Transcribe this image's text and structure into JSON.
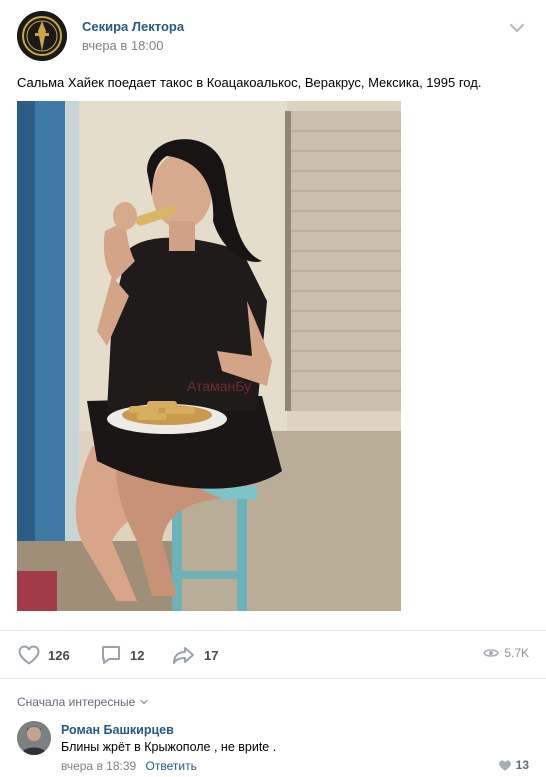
{
  "post": {
    "author": "Секира Лектора",
    "time": "вчера в 18:00",
    "text": "Сальма Хайек поедает такос в Коацакоалькос, Веракрус, Мексика, 1995 год.",
    "photo_watermark": "АтаманБу..."
  },
  "actions": {
    "likes": "126",
    "comments": "12",
    "shares": "17",
    "views": "5.7K"
  },
  "comments_section": {
    "sort_label": "Сначала интересные"
  },
  "comment": {
    "author": "Роман Башкирцев",
    "text": "Блины жрёт в Крыжополе , не вриte .",
    "time": "вчера в 18:39",
    "reply_label": "Ответить",
    "likes": "13"
  },
  "icons": {
    "menu": "chevron-down-icon",
    "like": "heart-icon",
    "comment": "comment-icon",
    "share": "share-arrow-icon",
    "views": "eye-icon",
    "sort": "chevron-down-icon"
  },
  "colors": {
    "link": "#2a5885",
    "muted": "#828282",
    "icon": "#99a2ad",
    "divider": "#e7e8ec"
  }
}
